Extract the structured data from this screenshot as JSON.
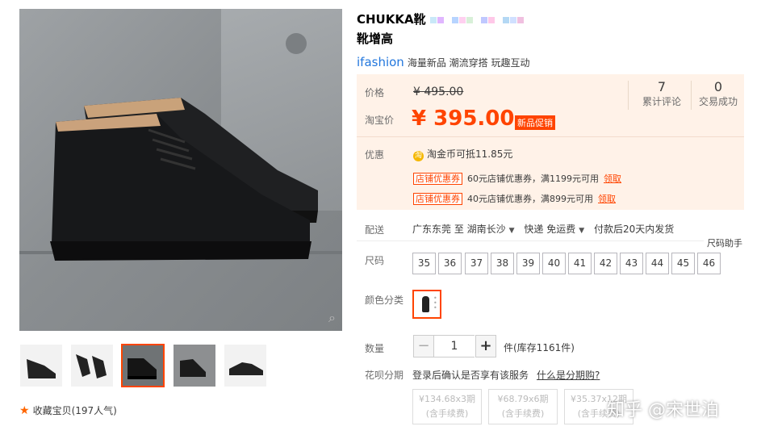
{
  "product": {
    "title_line1": "CHUKKA靴",
    "title_line2": "靴增高",
    "brand_logo": "ifashion",
    "brand_tags": "海量新品 潮流穿搭 玩趣互动"
  },
  "price": {
    "label_price": "价格",
    "original": "¥ 495.00",
    "label_taobao": "淘宝价",
    "current": "¥ 395.00",
    "promo_badge": "新品促销",
    "stats": [
      {
        "value": "7",
        "label": "累计评论"
      },
      {
        "value": "0",
        "label": "交易成功"
      }
    ],
    "label_discount": "优惠",
    "coin_icon": "淘",
    "coin_text": "淘金币可抵11.85元",
    "coupons": [
      {
        "tag": "店铺优惠券",
        "text": "60元店铺优惠券，满1199元可用",
        "action": "领取"
      },
      {
        "tag": "店铺优惠券",
        "text": "40元店铺优惠券，满899元可用",
        "action": "领取"
      }
    ]
  },
  "shipping": {
    "label": "配送",
    "from": "广东东莞 至",
    "to": "湖南长沙",
    "express": "快递 免运费",
    "ship_time": "付款后20天内发货"
  },
  "size": {
    "label": "尺码",
    "helper": "尺码助手",
    "options": [
      "35",
      "36",
      "37",
      "38",
      "39",
      "40",
      "41",
      "42",
      "43",
      "44",
      "45",
      "46"
    ]
  },
  "color": {
    "label": "颜色分类"
  },
  "quantity": {
    "label": "数量",
    "minus": "−",
    "value": "1",
    "plus": "+",
    "stock": "件(库存1161件)"
  },
  "huabei": {
    "label": "花呗分期",
    "note": "登录后确认是否享有该服务",
    "link": "什么是分期购?",
    "plans": [
      {
        "amount": "¥134.68x3期",
        "fee": "(含手续费)"
      },
      {
        "amount": "¥68.79x6期",
        "fee": "(含手续费)"
      },
      {
        "amount": "¥35.37x12期",
        "fee": "(含手续费)"
      }
    ]
  },
  "favorite": {
    "text": "收藏宝贝",
    "count": "(197人气)"
  },
  "watermark": "知乎 @宋世泊",
  "colors": {
    "accent": "#ff4400",
    "price_bg": "#fff2e8",
    "brand_blue": "#2277dd"
  },
  "icons": [
    "zoom-icon",
    "star-icon",
    "coin-icon",
    "chevron-down-icon",
    "shoe-thumbnail"
  ]
}
